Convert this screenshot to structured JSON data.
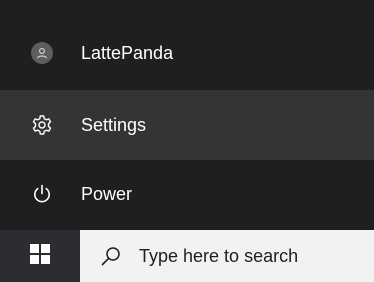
{
  "start_menu": {
    "items": [
      {
        "label": "LattePanda",
        "icon": "user-avatar-icon"
      },
      {
        "label": "Settings",
        "icon": "gear-icon"
      },
      {
        "label": "Power",
        "icon": "power-icon"
      }
    ],
    "hovered_item": "Settings"
  },
  "taskbar": {
    "start_button_icon": "windows-logo-icon",
    "search": {
      "icon": "search-icon",
      "placeholder": "Type here to search"
    }
  },
  "colors": {
    "menu_background": "#1f1f1f",
    "menu_hover": "#343434",
    "start_button_background": "#2b2d31",
    "search_background": "#f2f2f2",
    "text_light": "#ffffff",
    "text_dark": "#1e1e1e"
  }
}
